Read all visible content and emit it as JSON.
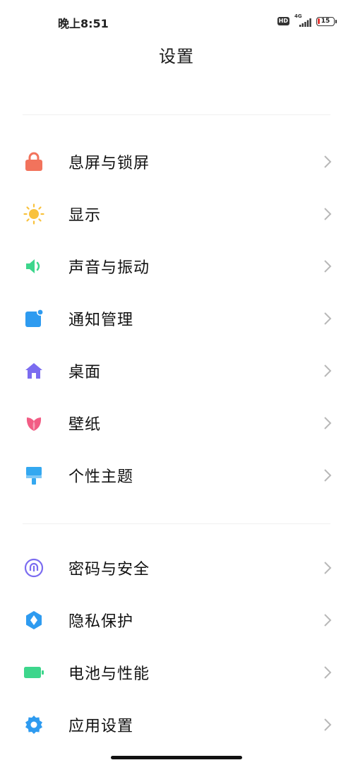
{
  "status_bar": {
    "time": "晚上8:51",
    "hd_label": "HD",
    "network_label": "4G",
    "battery_level": "15"
  },
  "header": {
    "title": "设置"
  },
  "groups": [
    {
      "items": [
        {
          "label": "息屏与锁屏",
          "icon": "lock-icon",
          "color": "#F2735C"
        },
        {
          "label": "显示",
          "icon": "sun-icon",
          "color": "#F9C23C"
        },
        {
          "label": "声音与振动",
          "icon": "speaker-icon",
          "color": "#3DD68C"
        },
        {
          "label": "通知管理",
          "icon": "notification-icon",
          "color": "#2E9BF0"
        },
        {
          "label": "桌面",
          "icon": "home-icon",
          "color": "#7B6CF0"
        },
        {
          "label": "壁纸",
          "icon": "tulip-icon",
          "color": "#F25C84"
        },
        {
          "label": "个性主题",
          "icon": "paintbrush-icon",
          "color": "#34A8F0"
        }
      ]
    },
    {
      "items": [
        {
          "label": "密码与安全",
          "icon": "fingerprint-icon",
          "color": "#7B6CF0"
        },
        {
          "label": "隐私保护",
          "icon": "privacy-shield-icon",
          "color": "#2E9BF0"
        },
        {
          "label": "电池与性能",
          "icon": "battery-icon",
          "color": "#3DD68C"
        },
        {
          "label": "应用设置",
          "icon": "gear-icon",
          "color": "#2E9BF0"
        }
      ]
    }
  ]
}
